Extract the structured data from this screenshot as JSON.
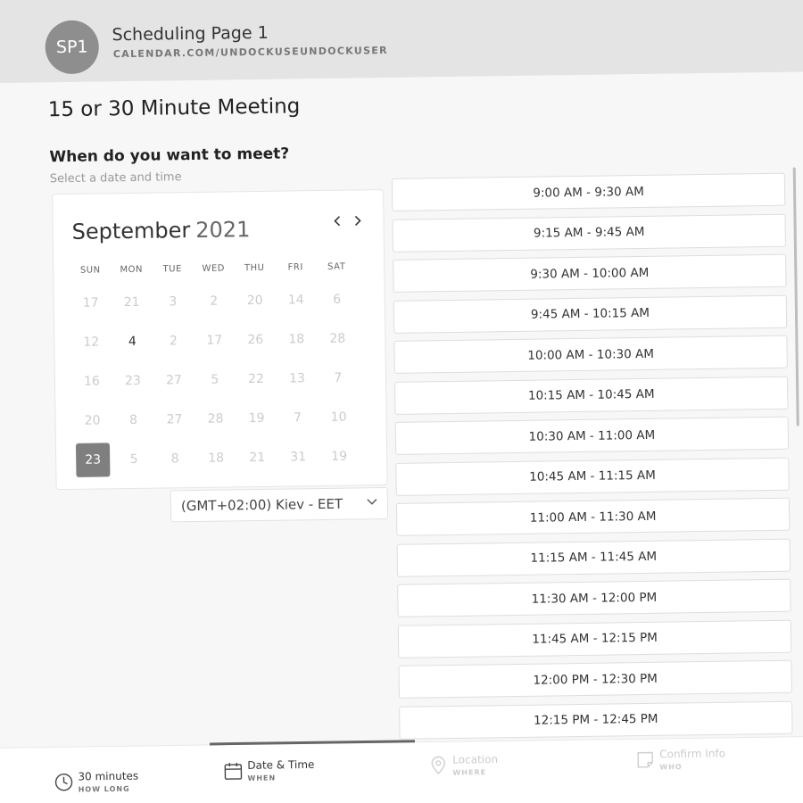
{
  "header": {
    "avatar_text": "SP1",
    "title": "Scheduling Page 1",
    "url": "CALENDAR.COM/UNDOCKUSEUNDOCKUSER"
  },
  "main": {
    "meeting_title": "15 or 30 Minute Meeting",
    "question": "When do you want to meet?",
    "subtitle": "Select a date and time"
  },
  "calendar": {
    "month": "September",
    "year": "2021",
    "prev_icon": "chevron-left-icon",
    "next_icon": "chevron-right-icon",
    "weekdays": [
      "SUN",
      "MON",
      "TUE",
      "WED",
      "THU",
      "FRI",
      "SAT"
    ],
    "weeks": [
      [
        "17",
        "21",
        "3",
        "2",
        "20",
        "14",
        "6"
      ],
      [
        "12",
        "4",
        "2",
        "17",
        "26",
        "18",
        "28"
      ],
      [
        "16",
        "23",
        "27",
        "5",
        "22",
        "13",
        "7"
      ],
      [
        "20",
        "8",
        "27",
        "28",
        "19",
        "7",
        "10"
      ],
      [
        "23",
        "5",
        "8",
        "18",
        "21",
        "31",
        "19"
      ]
    ],
    "available": [
      [
        1,
        1
      ]
    ],
    "selected": [
      4,
      0
    ]
  },
  "timezone": {
    "value": "(GMT+02:00) Kiev - EET",
    "icon": "chevron-down-icon"
  },
  "slots": [
    "9:00 AM - 9:30 AM",
    "9:15 AM - 9:45 AM",
    "9:30 AM - 10:00 AM",
    "9:45 AM - 10:15 AM",
    "10:00 AM - 10:30 AM",
    "10:15 AM - 10:45 AM",
    "10:30 AM - 11:00 AM",
    "10:45 AM - 11:15 AM",
    "11:00 AM - 11:30 AM",
    "11:15 AM - 11:45 AM",
    "11:30 AM - 12:00 PM",
    "11:45 AM - 12:15 PM",
    "12:00 PM - 12:30 PM",
    "12:15 PM - 12:45 PM"
  ],
  "footer": {
    "steps": [
      {
        "label": "30 minutes",
        "caption": "HOW LONG",
        "icon": "clock-icon",
        "active": true
      },
      {
        "label": "Date & Time",
        "caption": "WHEN",
        "icon": "calendar-icon",
        "active": true
      },
      {
        "label": "Location",
        "caption": "WHERE",
        "icon": "location-pin-icon",
        "active": false
      },
      {
        "label": "Confirm Info",
        "caption": "WHO",
        "icon": "note-icon",
        "active": false
      }
    ]
  },
  "colors": {
    "header_bg": "#e4e4e4",
    "avatar_bg": "#8e8e8e",
    "selected_day_bg": "#7f7f7f",
    "progress": "#666666"
  }
}
